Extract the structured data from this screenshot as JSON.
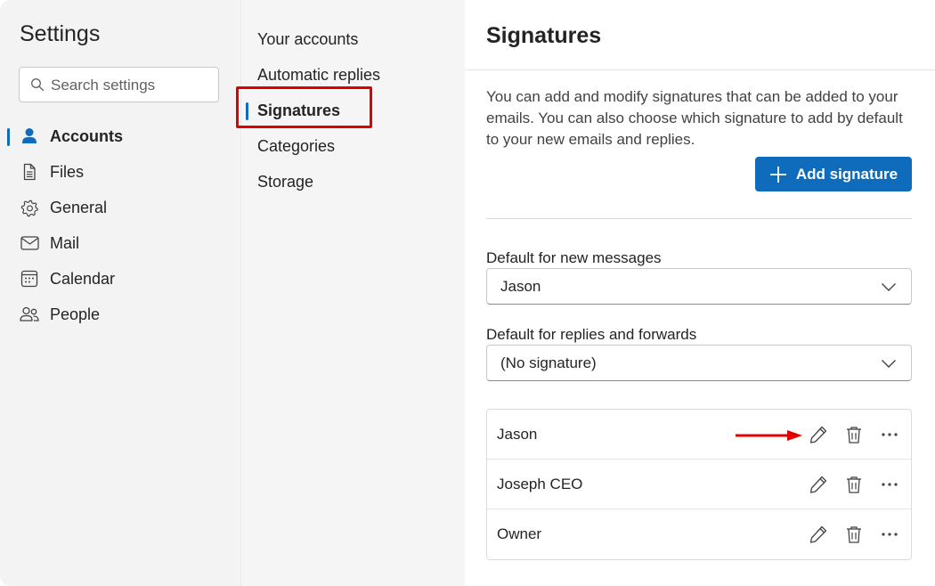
{
  "sidebar": {
    "title": "Settings",
    "search_placeholder": "Search settings",
    "items": [
      {
        "label": "Accounts",
        "icon": "person-icon",
        "active": true
      },
      {
        "label": "Files",
        "icon": "file-icon"
      },
      {
        "label": "General",
        "icon": "gear-icon"
      },
      {
        "label": "Mail",
        "icon": "mail-icon"
      },
      {
        "label": "Calendar",
        "icon": "calendar-icon"
      },
      {
        "label": "People",
        "icon": "people-icon"
      }
    ]
  },
  "subnav": {
    "items": [
      {
        "label": "Your accounts"
      },
      {
        "label": "Automatic replies"
      },
      {
        "label": "Signatures",
        "active": true
      },
      {
        "label": "Categories"
      },
      {
        "label": "Storage"
      }
    ]
  },
  "main": {
    "title": "Signatures",
    "description": "You can add and modify signatures that can be added to your emails. You can also choose which signature to add by default to your new emails and replies.",
    "add_button": "Add signature",
    "default_new": {
      "label": "Default for new messages",
      "value": "Jason"
    },
    "default_replies": {
      "label": "Default for replies and forwards",
      "value": "(No signature)"
    },
    "signatures": [
      {
        "name": "Jason"
      },
      {
        "name": "Joseph CEO"
      },
      {
        "name": "Owner"
      }
    ]
  },
  "colors": {
    "accent": "#0f6cbd",
    "annotation": "#e00000"
  }
}
